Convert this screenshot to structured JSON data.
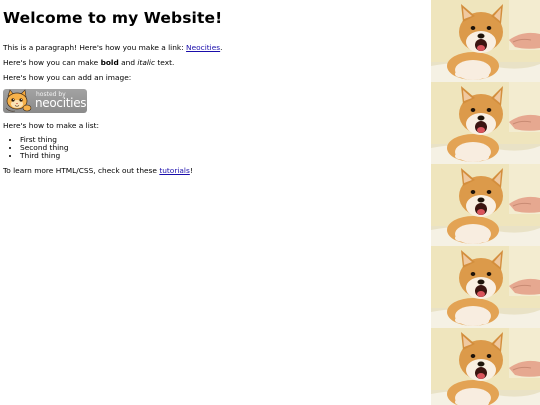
{
  "page": {
    "title": "Welcome to my Website!",
    "p1": {
      "before": "This is a paragraph! Here's how you make a link: ",
      "link": "Neocities",
      "after": "."
    },
    "p2": {
      "before": "Here's how you can make ",
      "bold": "bold",
      "middle": " and ",
      "italic": "italic",
      "after": " text."
    },
    "p3": "Here's how you can add an image:",
    "badge": {
      "small_text": "hosted by",
      "big_text": "neocities",
      "icon": "neocities-cat-icon"
    },
    "p4": "Here's how to make a list:",
    "list": [
      "First thing",
      "Second thing",
      "Third thing"
    ],
    "p5": {
      "before": "To learn more HTML/CSS, check out these ",
      "link": "tutorials",
      "after": "!"
    }
  },
  "background": {
    "image": "shiba-inu-doge-tile",
    "link_color": "#1a0dab"
  }
}
